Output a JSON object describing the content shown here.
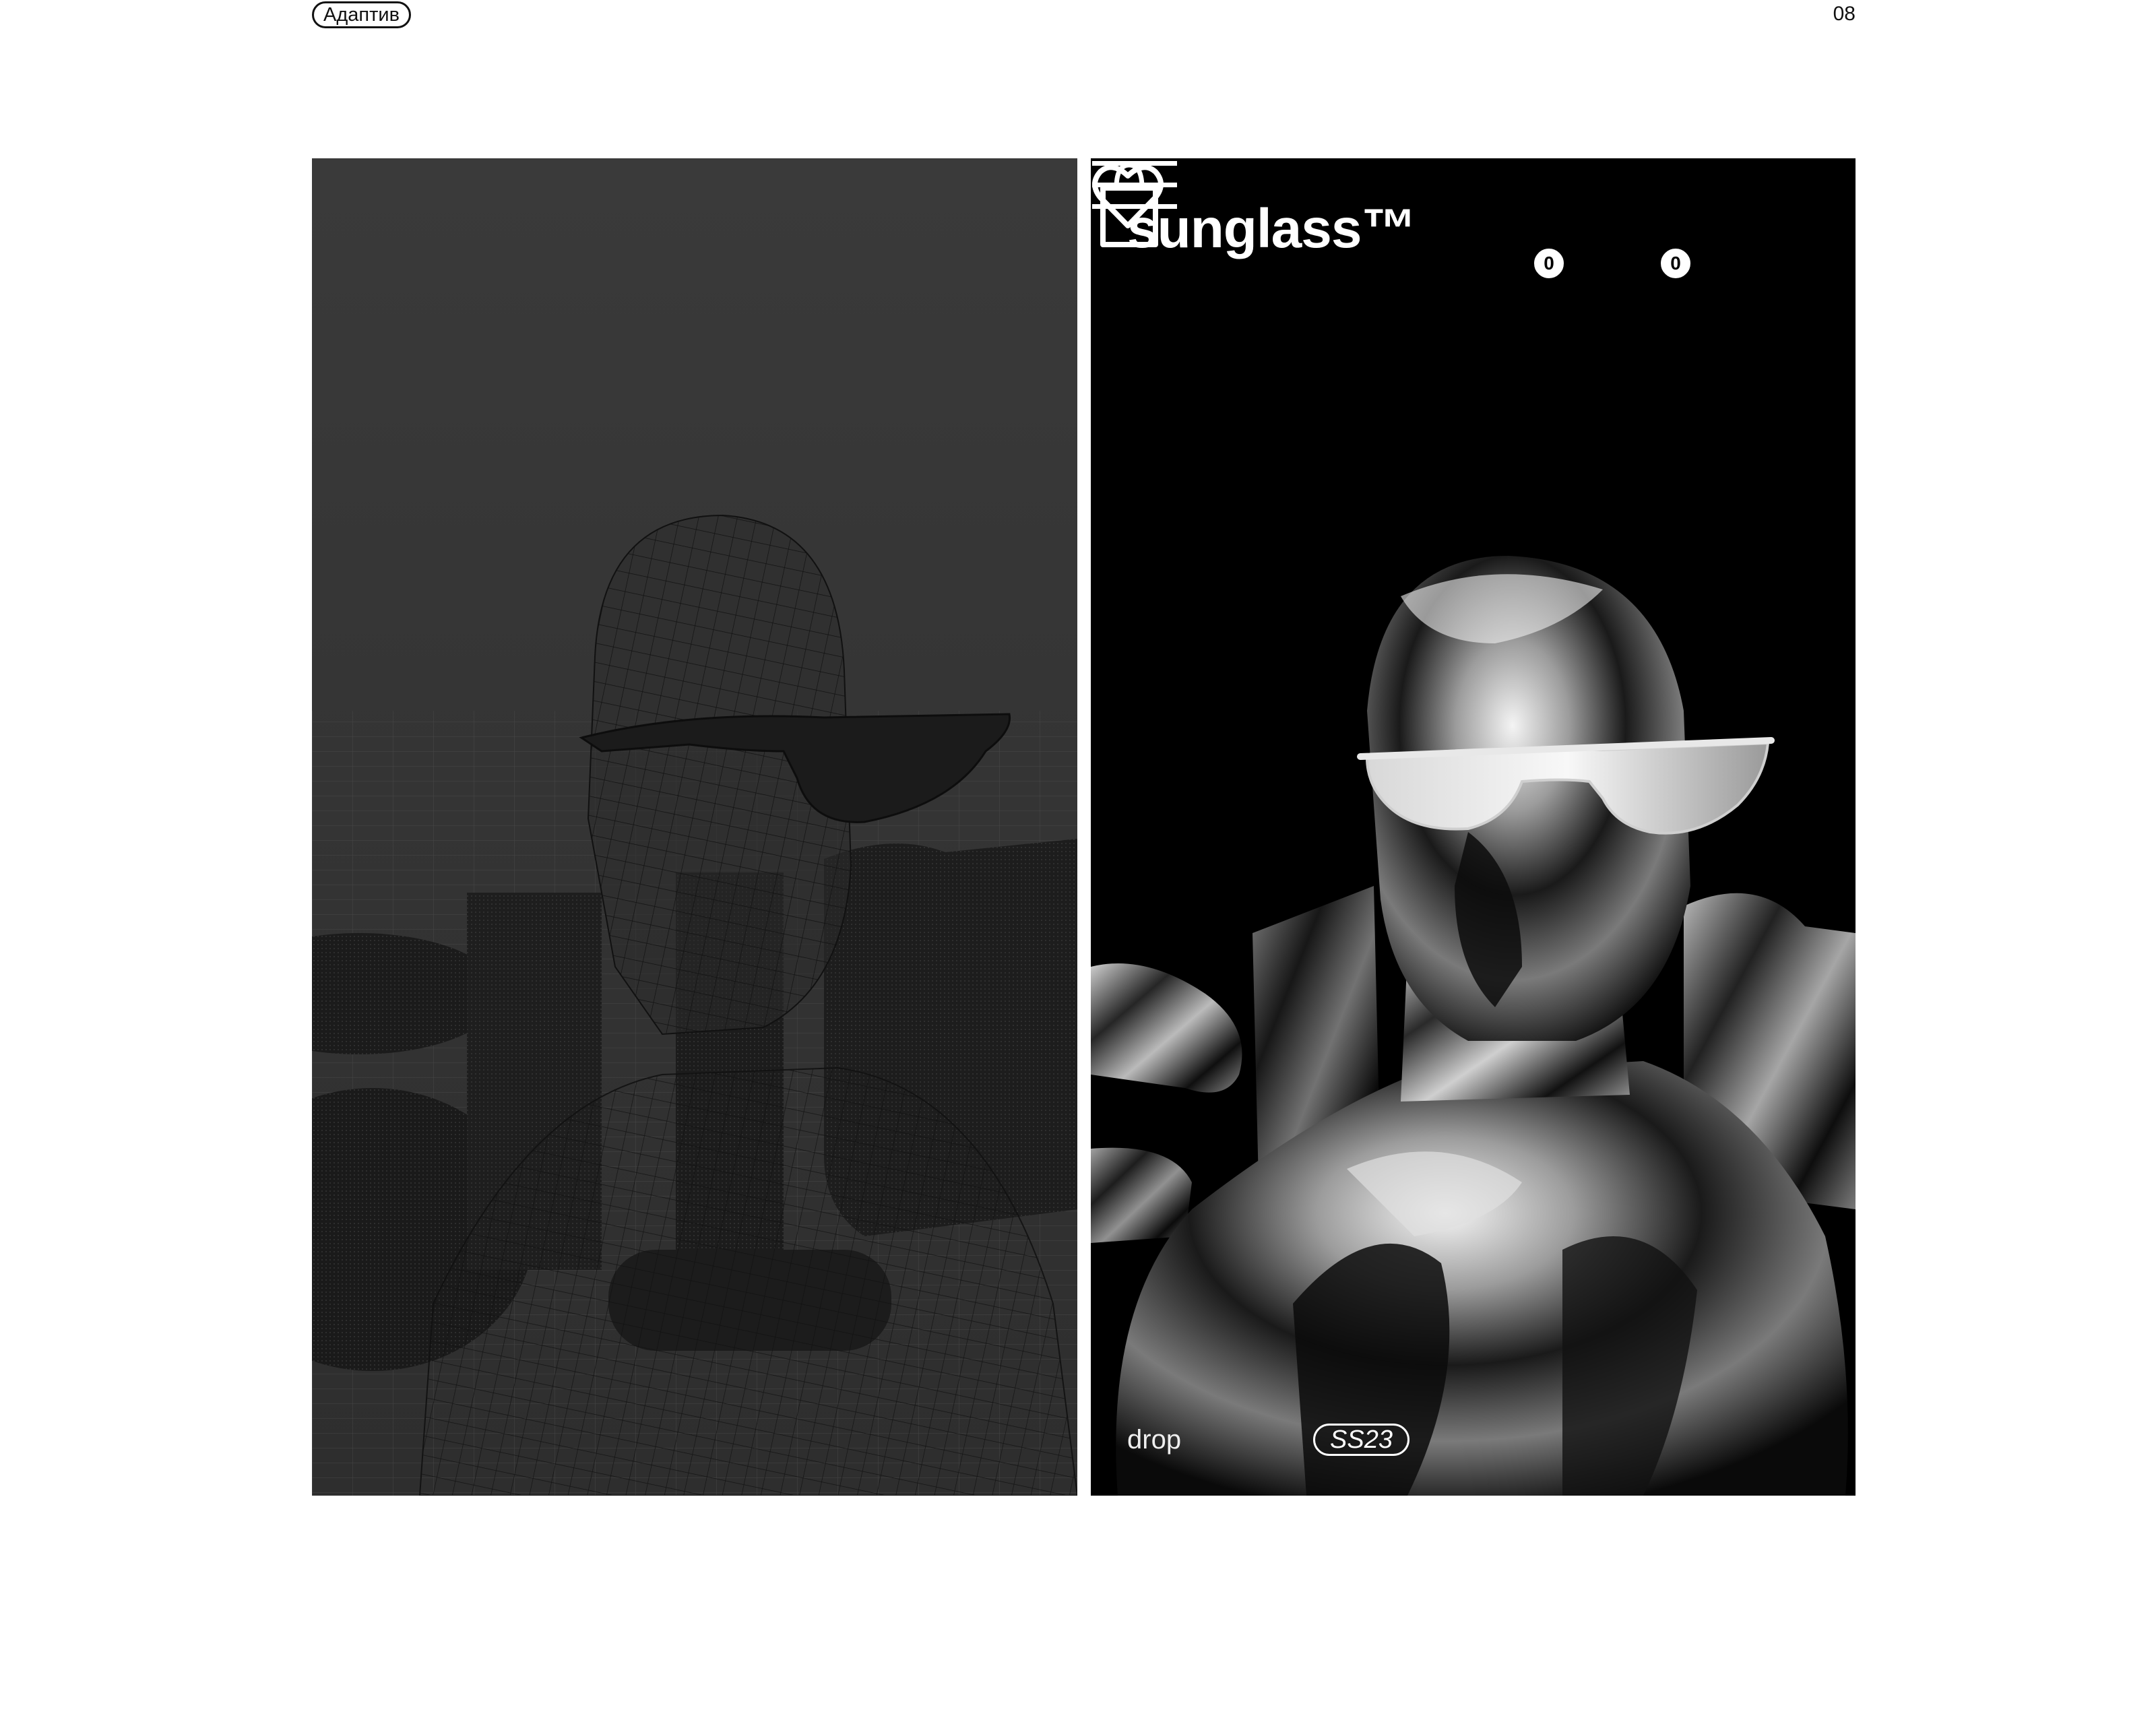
{
  "page": {
    "tag": "Адаптив",
    "number": "08"
  },
  "mobile_screen": {
    "logo": "sunglass™",
    "favorites_count": "0",
    "cart_count": "0",
    "drop_label": "drop",
    "season_tag": "SS23",
    "icons": [
      "heart-icon",
      "shopping-bag-icon",
      "hamburger-menu-icon"
    ]
  },
  "colors": {
    "background": "#ffffff",
    "wireframe_panel": "#383838",
    "screen_background": "#000000",
    "text_light": "#ffffff"
  }
}
